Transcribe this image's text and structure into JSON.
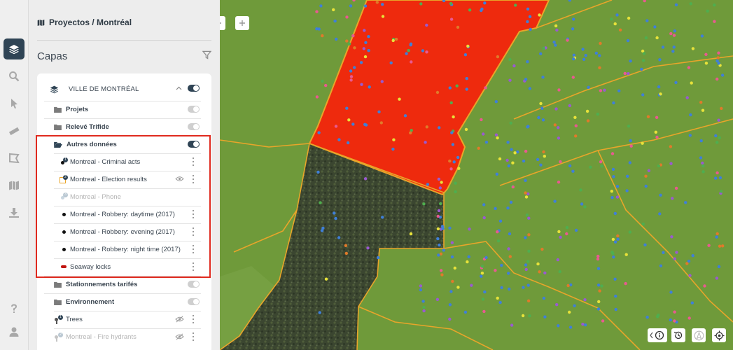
{
  "breadcrumb": "Proyectos / Montréal",
  "panel_title": "Capas",
  "group": {
    "title": "VILLE DE MONTRÉAL",
    "items": [
      {
        "label": "Projets",
        "kind": "folder"
      },
      {
        "label": "Relevé Trifide",
        "kind": "folder"
      },
      {
        "label": "Autres données",
        "kind": "folder-open"
      },
      {
        "label": "Montreal - Criminal acts",
        "kind": "layer"
      },
      {
        "label": "Montreal - Election results",
        "kind": "layer"
      },
      {
        "label": "Montreal - Phone",
        "kind": "layer"
      },
      {
        "label": "Montreal - Robbery: daytime (2017)",
        "kind": "layer"
      },
      {
        "label": "Montreal - Robbery: evening (2017)",
        "kind": "layer"
      },
      {
        "label": "Montreal - Robbery: night time (2017)",
        "kind": "layer"
      },
      {
        "label": "Seaway locks",
        "kind": "layer"
      },
      {
        "label": "Stationnements tarifés",
        "kind": "folder"
      },
      {
        "label": "Environnement",
        "kind": "folder"
      },
      {
        "label": "Trees",
        "kind": "layer"
      },
      {
        "label": "Montreal - Fire hydrants",
        "kind": "layer"
      }
    ]
  },
  "badges": {
    "criminal": "1",
    "election": "2",
    "phone": "3",
    "trees": "1",
    "hydrants": "2"
  },
  "colors": {
    "accent": "#2f4455",
    "highlight": "#e02a1e",
    "map_green": "#6f9a3a",
    "map_red": "#ee2a0d",
    "map_border": "#e8a52a"
  },
  "icons": [
    "layers-icon",
    "search-icon",
    "pointer-icon",
    "ruler-icon",
    "polygon-icon",
    "map-icon",
    "download-icon",
    "help-icon",
    "user-icon",
    "filter-icon",
    "info-icon",
    "history-icon",
    "north-icon",
    "locate-icon"
  ]
}
